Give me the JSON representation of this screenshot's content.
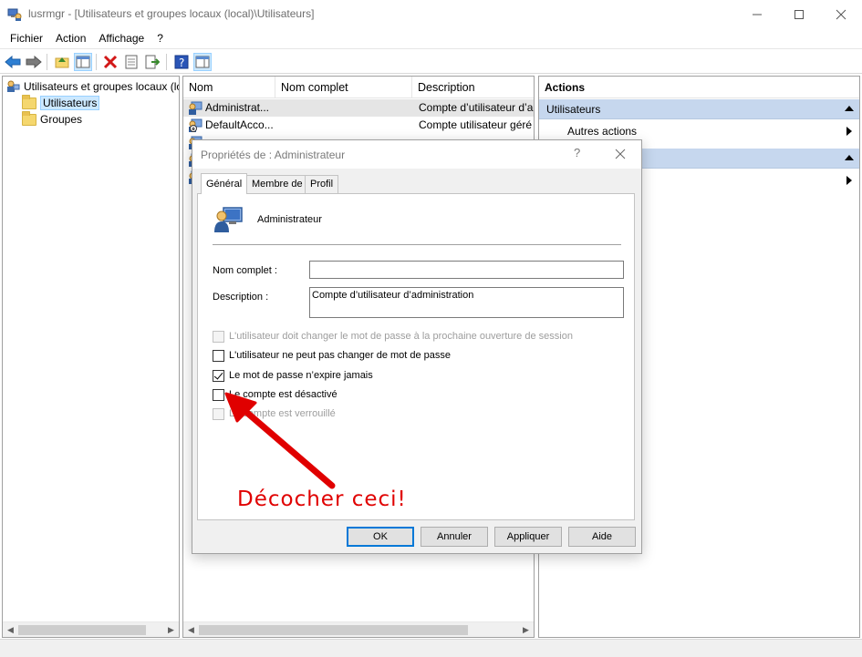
{
  "window": {
    "title": "lusrmgr - [Utilisateurs et groupes locaux (local)\\Utilisateurs]",
    "min_icon": "minimize-icon",
    "max_icon": "maximize-icon",
    "close_icon": "close-icon"
  },
  "menu": [
    "Fichier",
    "Action",
    "Affichage",
    "?"
  ],
  "tree": {
    "root": "Utilisateurs et groupes locaux (lo",
    "items": [
      "Utilisateurs",
      "Groupes"
    ]
  },
  "list": {
    "columns": [
      "Nom",
      "Nom complet",
      "Description"
    ],
    "rows": [
      {
        "name": "Administrat...",
        "full_name": "",
        "description": "Compte d’utilisateur d’a"
      },
      {
        "name": "DefaultAcco...",
        "full_name": "",
        "description": "Compte utilisateur géré"
      }
    ]
  },
  "actions": {
    "title": "Actions",
    "section1": "Utilisateurs",
    "item1": "Autres actions"
  },
  "dialog": {
    "title": "Propriétés de : Administrateur",
    "help": "?",
    "tabs": [
      "Général",
      "Membre de",
      "Profil"
    ],
    "username": "Administrateur",
    "full_name_label": "Nom complet :",
    "full_name_value": "",
    "description_label": "Description :",
    "description_value": "Compte d’utilisateur d’administration",
    "checkboxes": [
      {
        "label": "L'utilisateur doit changer le mot de passe à la prochaine ouverture de session",
        "checked": false,
        "disabled": true
      },
      {
        "label": "L'utilisateur ne peut pas changer de mot de passe",
        "checked": false,
        "disabled": false
      },
      {
        "label": "Le mot de passe n’expire jamais",
        "checked": true,
        "disabled": false
      },
      {
        "label": "Le compte est désactivé",
        "checked": false,
        "disabled": false
      },
      {
        "label": "Le compte est verrouillé",
        "checked": false,
        "disabled": true
      }
    ],
    "buttons": {
      "ok": "OK",
      "cancel": "Annuler",
      "apply": "Appliquer",
      "help": "Aide"
    }
  },
  "annotation": {
    "text": "Décocher ceci!",
    "color": "#e00000"
  },
  "colors": {
    "selection": "#cce8ff",
    "action_section": "#c6d7ee",
    "dialog_default_border": "#0078d7"
  }
}
